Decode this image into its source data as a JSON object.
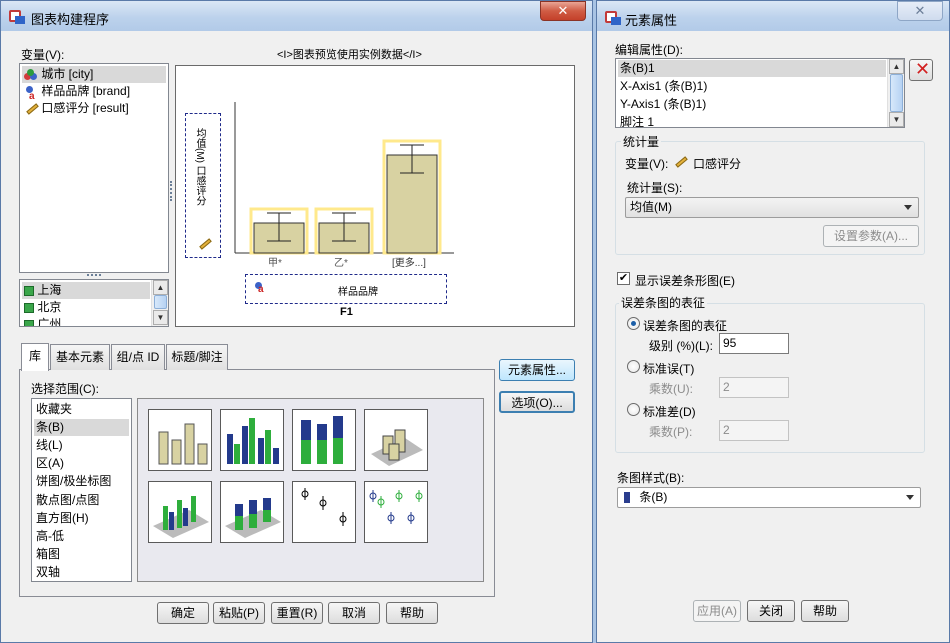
{
  "left_window": {
    "title": "图表构建程序",
    "variables_label": "变量(V):",
    "preview_caption": "<I>图表预览使用实例数据</I>",
    "variables": [
      {
        "label": "城市 [city]",
        "icon": "nominal-icon"
      },
      {
        "label": "样品品牌 [brand]",
        "icon": "nominal-string-icon"
      },
      {
        "label": "口感评分 [result]",
        "icon": "scale-ruler-icon"
      }
    ],
    "values": [
      "上海",
      "北京",
      "广州"
    ],
    "preview": {
      "y_drop_label": "均值(M) 口感评分",
      "categories": [
        "甲*",
        "乙*",
        "[更多...]"
      ],
      "x_drop_label": "样品品牌",
      "figure_label": "F1"
    },
    "side_buttons": {
      "element_properties": "元素属性...",
      "options": "选项(O)..."
    },
    "tabs": [
      "库",
      "基本元素",
      "组/点 ID",
      "标题/脚注"
    ],
    "choose_from_label": "选择范围(C):",
    "gallery_types": [
      "收藏夹",
      "条(B)",
      "线(L)",
      "区(A)",
      "饼图/极坐标图",
      "散点图/点图",
      "直方图(H)",
      "高-低",
      "箱图",
      "双轴"
    ],
    "thumbnails": [
      "simple-bar-icon",
      "clustered-bar-icon",
      "stacked-bar-icon",
      "3d-bar-icon",
      "3d-clustered-bar-icon",
      "3d-stacked-bar-icon",
      "error-bar-icon",
      "clustered-error-bar-icon"
    ],
    "bottom_buttons": [
      "确定",
      "粘贴(P)",
      "重置(R)",
      "取消",
      "帮助"
    ]
  },
  "right_window": {
    "title": "元素属性",
    "edit_properties_label": "编辑属性(D):",
    "properties": [
      "条(B)1",
      "X-Axis1 (条(B)1)",
      "Y-Axis1 (条(B)1)",
      "脚注 1"
    ],
    "statistics_group": "统计量",
    "variable_label": "变量(V):",
    "variable_value": "口感评分",
    "statistic_label": "统计量(S):",
    "statistic_value": "均值(M)",
    "set_params_button": "设置参数(A)...",
    "show_error_bars_label": "显示误差条形图(E)",
    "error_bars_group": "误差条图的表征",
    "ci_label": "误差条图的表征",
    "level_label": "级别 (%)(L):",
    "level_value": "95",
    "se_label": "标准误(T)",
    "se_multiplier_label": "乘数(U):",
    "se_multiplier_value": "2",
    "sd_label": "标准差(D)",
    "sd_multiplier_label": "乘数(P):",
    "sd_multiplier_value": "2",
    "bar_style_label": "条图样式(B):",
    "bar_style_value": "条(B)",
    "bottom_buttons": [
      "应用(A)",
      "关闭",
      "帮助"
    ]
  },
  "colors": {
    "bar_fill": "#d8d2a2",
    "highlight": "#ffe98c",
    "close_red": "#c4402a",
    "delete_red": "#d22020"
  }
}
